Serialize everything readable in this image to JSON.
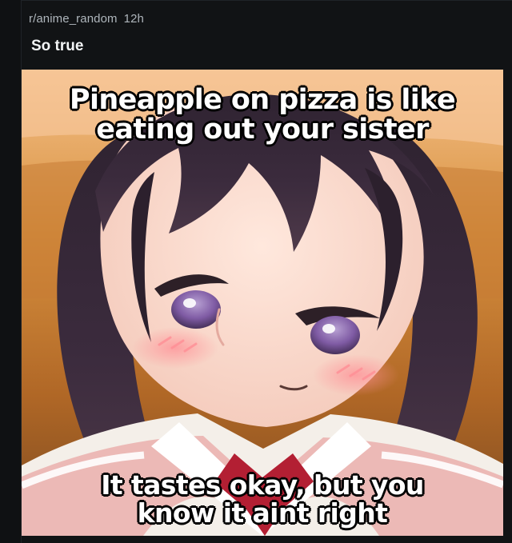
{
  "post": {
    "subreddit": "r/anime_random",
    "age": "12h",
    "title": "So true"
  },
  "meme": {
    "top_lines": [
      "Pineapple on pizza is like",
      "eating out your sister"
    ],
    "bottom_lines": [
      "It tastes okay, but you",
      "know it aint right"
    ]
  },
  "colors": {
    "background": "#0f1113",
    "card": "#111315",
    "meta_text": "#aeb5bb",
    "title_text": "#f2f4f5",
    "image_background": "#d9964a",
    "hair": "#3b2c3c",
    "eyes": "#8f73a8",
    "tie": "#b31f33"
  },
  "icons": {
    "media": "meme-image"
  }
}
